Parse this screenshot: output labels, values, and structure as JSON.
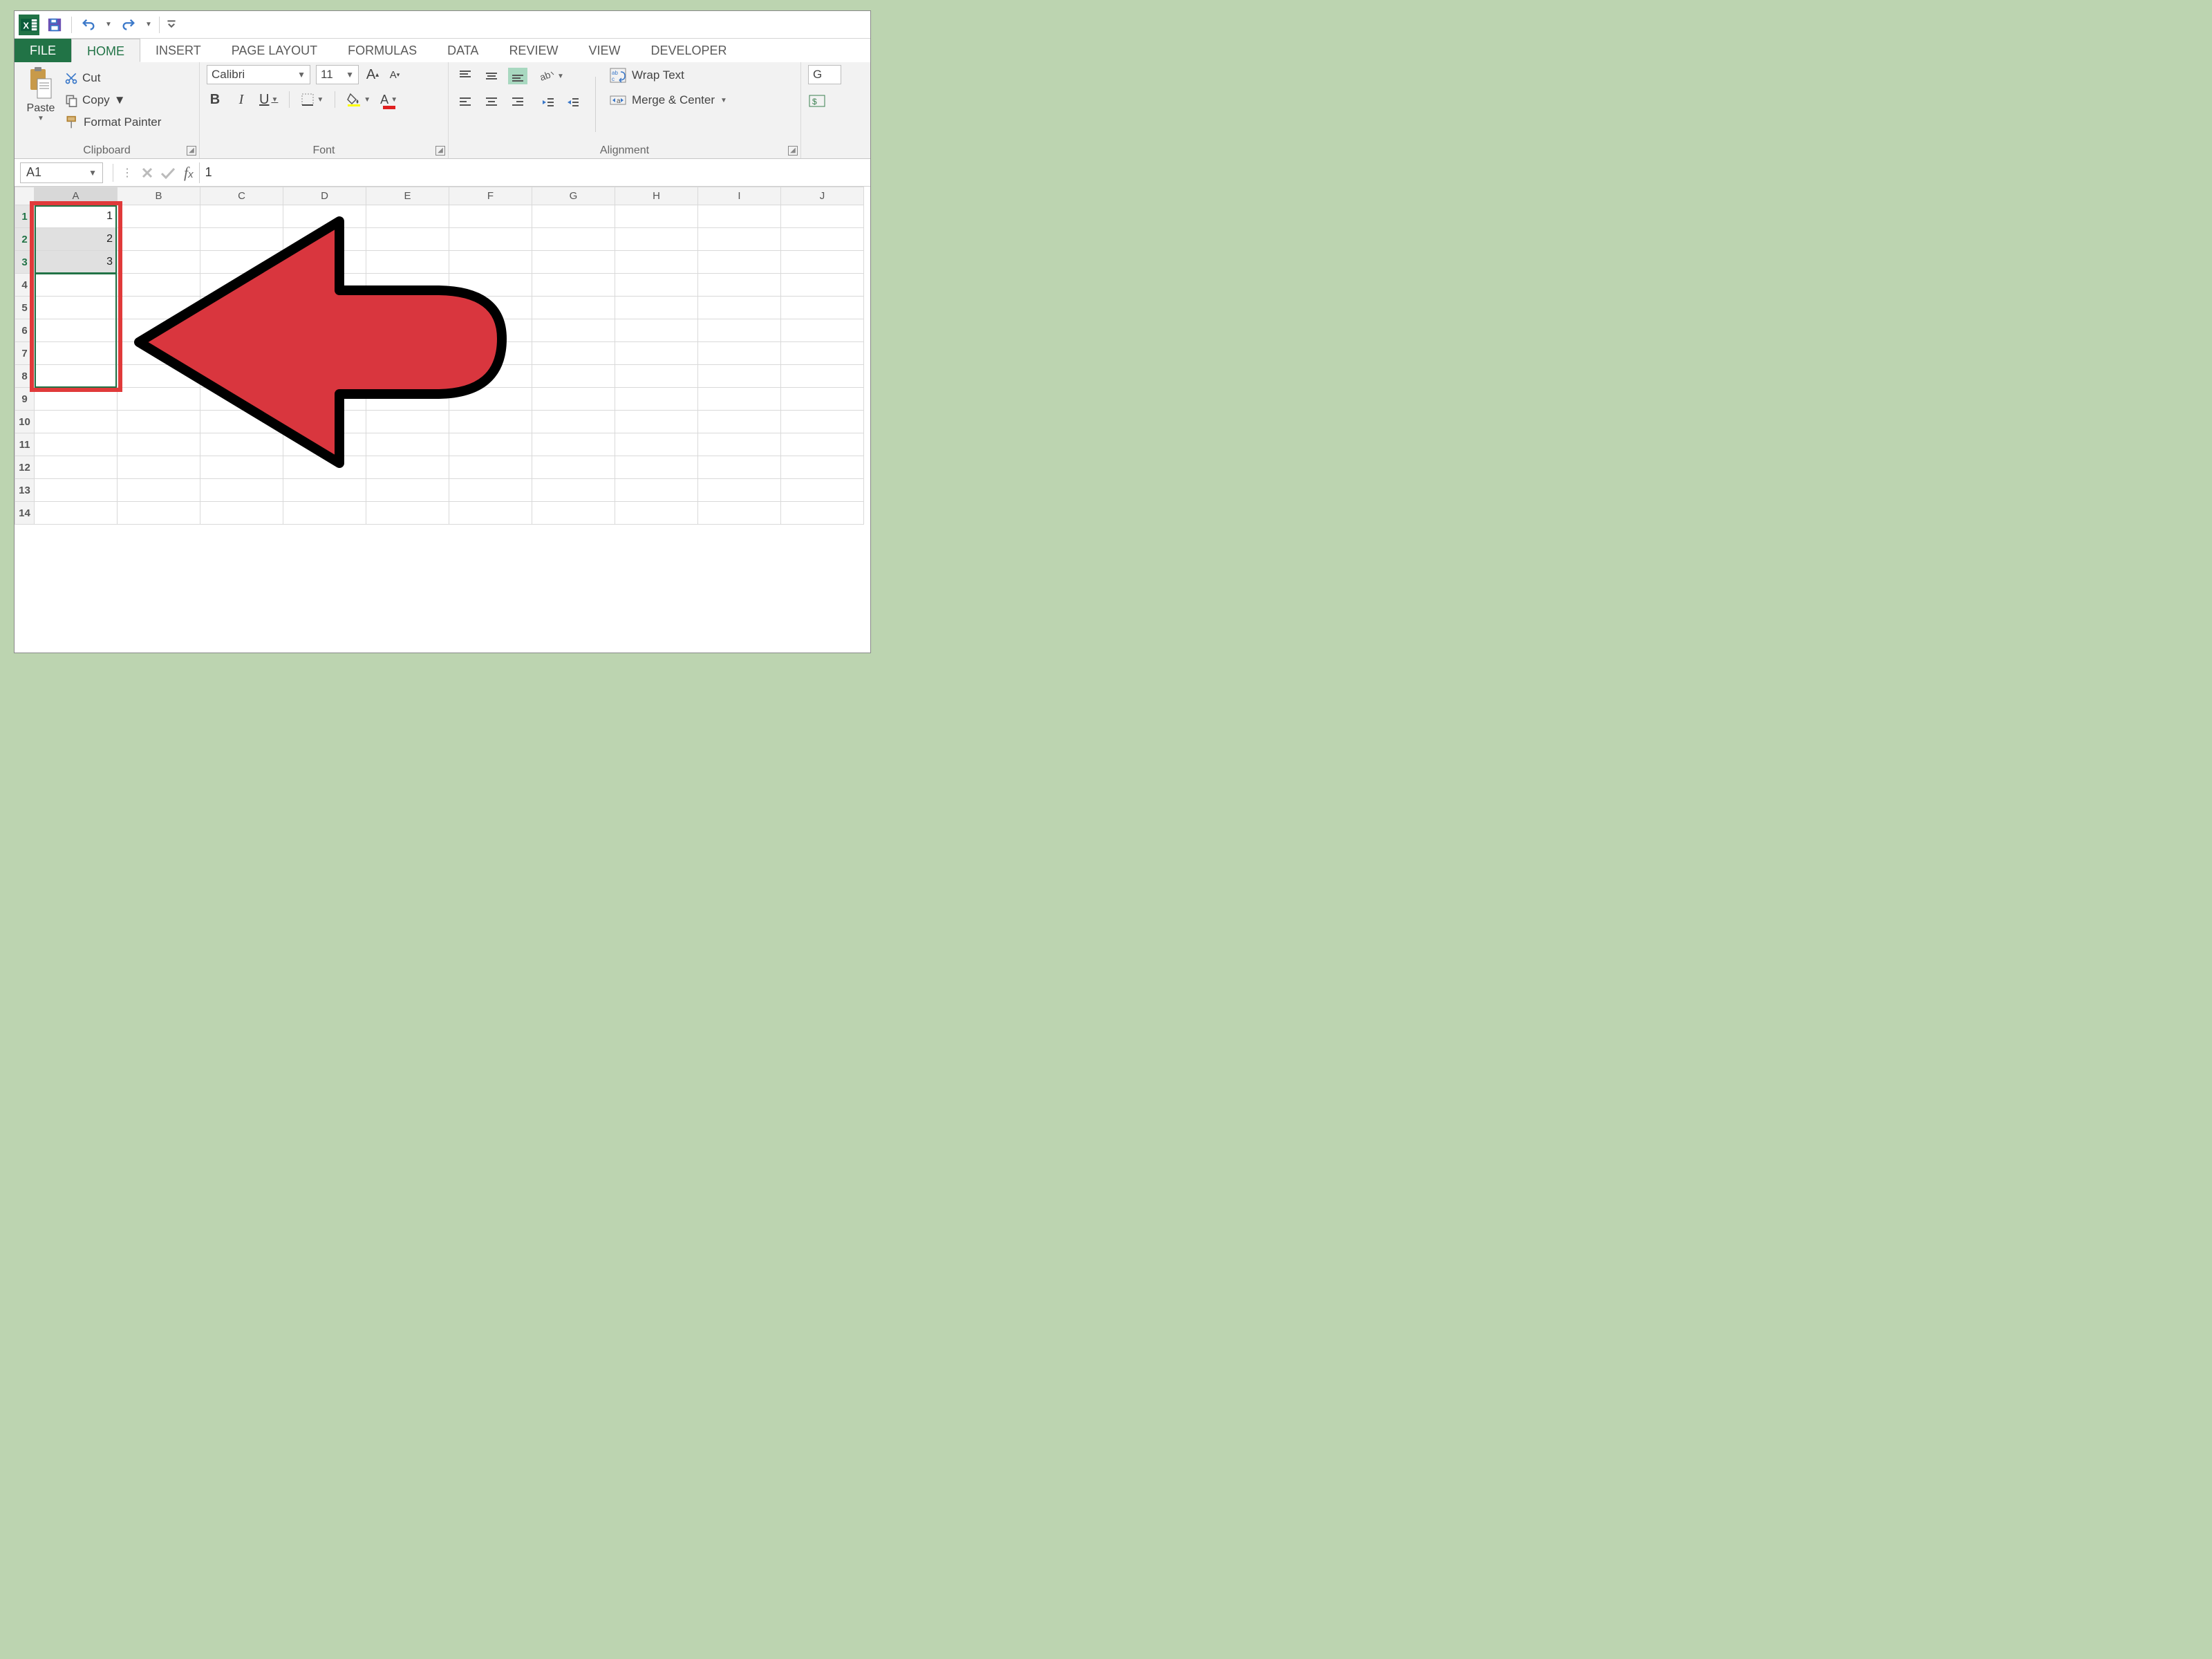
{
  "qat": {
    "save": "save",
    "undo": "undo",
    "redo": "redo"
  },
  "tabs": {
    "file": "FILE",
    "home": "HOME",
    "insert": "INSERT",
    "pagelayout": "PAGE LAYOUT",
    "formulas": "FORMULAS",
    "data": "DATA",
    "review": "REVIEW",
    "view": "VIEW",
    "developer": "DEVELOPER"
  },
  "ribbon": {
    "clipboard": {
      "paste": "Paste",
      "cut": "Cut",
      "copy": "Copy",
      "fpainter": "Format Painter",
      "label": "Clipboard"
    },
    "font": {
      "name": "Calibri",
      "size": "11",
      "bold": "B",
      "italic": "I",
      "underline": "U",
      "label": "Font",
      "growA": "A",
      "shrinkA": "A"
    },
    "alignment": {
      "wrap": "Wrap Text",
      "merge": "Merge & Center",
      "label": "Alignment"
    },
    "number": {
      "general_initial": "G"
    }
  },
  "fxbar": {
    "namebox": "A1",
    "formula": "1"
  },
  "columns": [
    "A",
    "B",
    "C",
    "D",
    "E",
    "F",
    "G",
    "H",
    "I",
    "J"
  ],
  "rows": [
    "1",
    "2",
    "3",
    "4",
    "5",
    "6",
    "7",
    "8",
    "9",
    "10",
    "11",
    "12",
    "13",
    "14"
  ],
  "cells": {
    "A1": "1",
    "A2": "2",
    "A3": "3"
  }
}
